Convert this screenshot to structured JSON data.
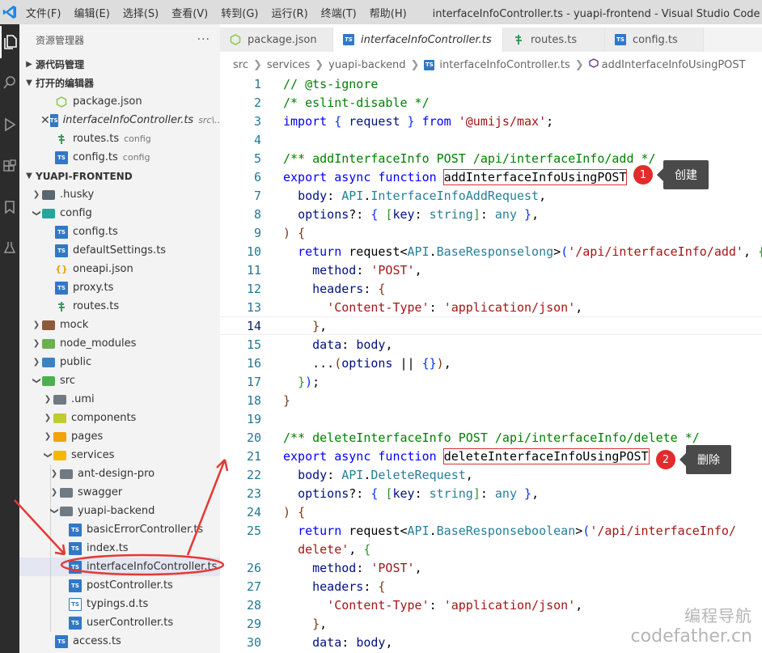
{
  "titlebar": {
    "menu": [
      "文件(F)",
      "编辑(E)",
      "选择(S)",
      "查看(V)",
      "转到(G)",
      "运行(R)",
      "终端(T)",
      "帮助(H)"
    ],
    "window_title": "interfaceInfoController.ts - yuapi-frontend - Visual Studio Code [管理..."
  },
  "sidebar": {
    "header": "资源管理器",
    "more": "···",
    "sections": {
      "scm": "源代码管理",
      "open_editors": "打开的编辑器",
      "project": "YUAPI-FRONTEND"
    },
    "open_editors": [
      {
        "name": "package.json",
        "sub": ""
      },
      {
        "name": "interfaceInfoController.ts",
        "sub": "src\\..."
      },
      {
        "name": "routes.ts",
        "sub": "config"
      },
      {
        "name": "config.ts",
        "sub": "config"
      }
    ],
    "tree": [
      ".husky",
      "config",
      "config.ts",
      "defaultSettings.ts",
      "oneapi.json",
      "proxy.ts",
      "routes.ts",
      "mock",
      "node_modules",
      "public",
      "src",
      ".umi",
      "components",
      "pages",
      "services",
      "ant-design-pro",
      "swagger",
      "yuapi-backend",
      "basicErrorController.ts",
      "index.ts",
      "interfaceInfoController.ts",
      "postController.ts",
      "typings.d.ts",
      "userController.ts",
      "access.ts"
    ]
  },
  "tabs": [
    "package.json",
    "interfaceInfoController.ts",
    "routes.ts",
    "config.ts"
  ],
  "breadcrumb": [
    "src",
    "services",
    "yuapi-backend",
    "interfaceInfoController.ts",
    "addInterfaceInfoUsingPOST"
  ],
  "editor": {
    "line_numbers": [
      "1",
      "2",
      "3",
      "4",
      "5",
      "6",
      "7",
      "8",
      "9",
      "10",
      "11",
      "12",
      "13",
      "14",
      "15",
      "16",
      "17",
      "18",
      "19",
      "20",
      "21",
      "22",
      "23",
      "24",
      "25",
      "",
      "26",
      "27",
      "28",
      "29",
      "30"
    ],
    "callouts": [
      {
        "num": "1",
        "label": "创建"
      },
      {
        "num": "2",
        "label": "删除"
      }
    ]
  },
  "watermark": {
    "line1": "编程导航",
    "line2": "codefather.cn"
  },
  "colors": {
    "accent": "#e32b2b",
    "ts_blue": "#3178c6",
    "keyword": "#0000ff",
    "comment": "#008000",
    "string": "#a31515"
  }
}
